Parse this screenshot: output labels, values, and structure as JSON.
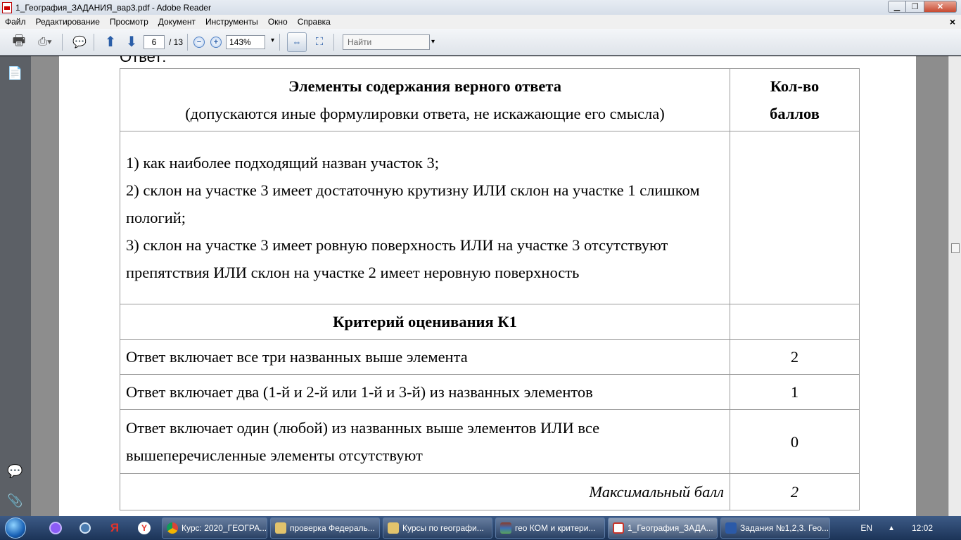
{
  "window": {
    "title": "1_География_ЗАДАНИЯ_вар3.pdf - Adobe Reader"
  },
  "menu": {
    "items": [
      "Файл",
      "Редактирование",
      "Просмотр",
      "Документ",
      "Инструменты",
      "Окно",
      "Справка"
    ]
  },
  "toolbar": {
    "page_current": "6",
    "page_total": "/ 13",
    "zoom": "143%",
    "find_placeholder": "Найти"
  },
  "document": {
    "answer_label": "Ответ:",
    "table": {
      "header_col1_line1": "Элементы содержания верного ответа",
      "header_col1_line2": "(допускаются иные формулировки ответа, не искажающие его смысла)",
      "header_col2_line1": "Кол-во",
      "header_col2_line2": "баллов",
      "elements": [
        "1) как наиболее подходящий назван участок 3;",
        "2) склон на участке 3 имеет достаточную крутизну ИЛИ склон на участке 1 слишком пологий;",
        "3) склон на участке 3 имеет ровную поверхность ИЛИ на участке 3 отсутствуют препятствия ИЛИ склон на участке 2 имеет неровную поверхность"
      ],
      "criterion_title": "Критерий оценивания К1",
      "criteria": [
        {
          "text": "Ответ включает все три названных выше элемента",
          "score": "2"
        },
        {
          "text": "Ответ включает два (1-й и 2-й или 1-й и 3-й) из названных элементов",
          "score": "1"
        },
        {
          "text": "Ответ включает один (любой) из названных выше элементов ИЛИ все вышеперечисленные элементы отсутствуют",
          "score": "0"
        }
      ],
      "max_label": "Максимальный балл",
      "max_value": "2"
    }
  },
  "taskbar": {
    "tasks": [
      {
        "label": "Курс: 2020_ГЕОГРА...",
        "color": "#e8b64a"
      },
      {
        "label": "проверка Федераль...",
        "color": "#e2c36c"
      },
      {
        "label": "Курсы по географи...",
        "color": "#e2c36c"
      },
      {
        "label": "гео КОМ и критери...",
        "color": "#8a3c2a"
      },
      {
        "label": "1_География_ЗАДА...",
        "color": "#c9342a"
      },
      {
        "label": "Задания №1,2,3. Гео...",
        "color": "#2b5aa8"
      }
    ],
    "lang": "EN",
    "clock": "12:02"
  }
}
